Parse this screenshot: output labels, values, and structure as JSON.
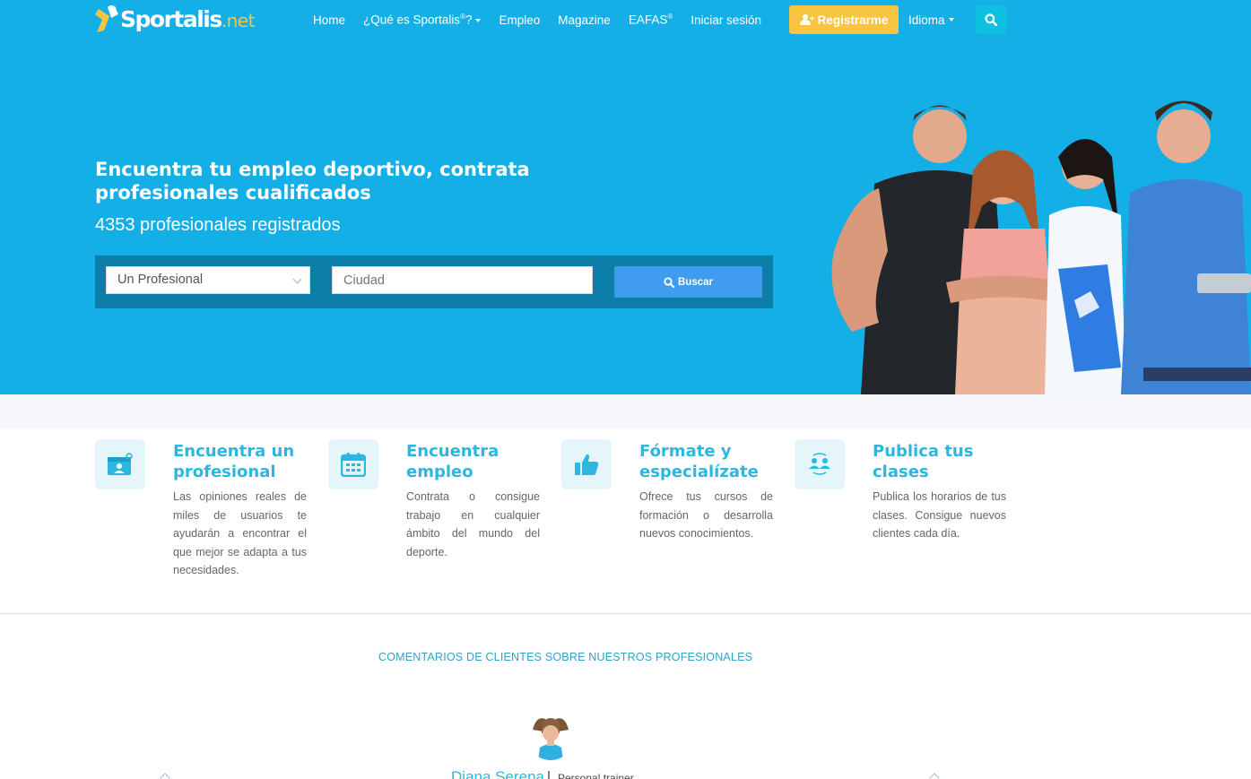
{
  "brand": {
    "name": "Sportalis",
    "suffix": ".net"
  },
  "nav": {
    "home": "Home",
    "que_es": "¿Qué es Sportalis",
    "que_es_sup": "®",
    "que_es_end": "?",
    "empleo": "Empleo",
    "magazine": "Magazine",
    "eafas": "EAFAS",
    "eafas_sup": "®",
    "login": "Iniciar sesión",
    "register": "Registrarme",
    "language": "Idioma"
  },
  "hero": {
    "title": "Encuentra tu empleo deportivo, contrata profesionales cualificados",
    "subtitle": "4353 profesionales registrados",
    "select_value": "Un Profesional",
    "city_placeholder": "Ciudad",
    "search_label": "Buscar"
  },
  "features": [
    {
      "icon": "profile-card-icon",
      "title": "Encuentra un profesional",
      "text": "Las opiniones reales de miles de usuarios te ayudarán a encontrar el que mejor se adapta a tus necesidades."
    },
    {
      "icon": "calendar-icon",
      "title": "Encuentra empleo",
      "text": "Contrata o consigue trabajo en cualquier ámbito del mundo del deporte."
    },
    {
      "icon": "thumbs-up-icon",
      "title": "Fórmate y especialízate",
      "text": "Ofrece tus cursos de formación o desarrolla nuevos conocimientos."
    },
    {
      "icon": "people-exchange-icon",
      "title": "Publica tus clases",
      "text": "Publica los horarios de tus clases. Consigue nuevos clientes cada día."
    }
  ],
  "comments": {
    "title": "COMENTARIOS DE CLIENTES SOBRE NUESTROS PROFESIONALES",
    "reviewer_name": "Diana Serena",
    "separator": "|",
    "reviewer_role": "Personal trainer"
  },
  "colors": {
    "hero_bg": "#13afe6",
    "accent_yellow": "#f9c442",
    "search_blue": "#3f9cef",
    "title_cyan": "#2bb7e0"
  }
}
